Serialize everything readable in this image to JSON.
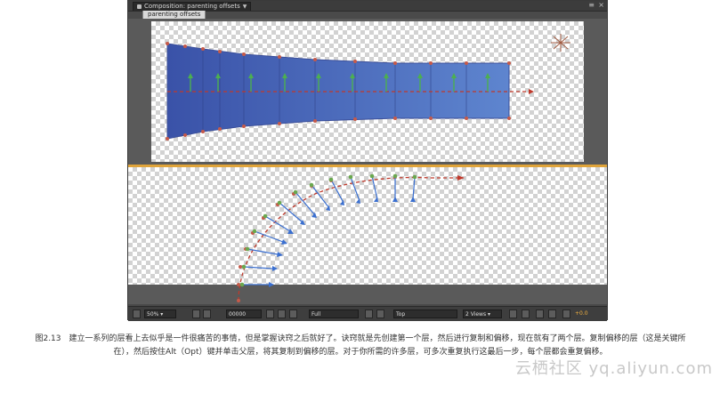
{
  "window": {
    "comp_tab_label": "Composition: parenting offsets",
    "breadcrumb": "parenting offsets",
    "panel_menu_glyph": "≡",
    "close_glyph": "×"
  },
  "statusbar": {
    "zoom": "50%",
    "timecode": "00000",
    "resolution": "Full",
    "view": "Top",
    "view_layout": "2 Views",
    "exposure": "+0.0"
  },
  "caption": {
    "text": "图2.13　建立一系列的层看上去似乎是一件很痛苦的事情，但是掌握诀窍之后就好了。诀窍就是先创建第一个层，然后进行复制和偏移，现在就有了两个层。复制偏移的层（这是关键所在），然后按住Alt（Opt）键并单击父层，将其复制到偏移的层。对于你所需的许多层，可多次重复执行这最后一步，每个层都会重复偏移。"
  },
  "watermark": {
    "text": "云栖社区 yq.aliyun.com"
  },
  "colors": {
    "panel": "#4a4a4a",
    "viewer_bg": "#5a5a5a",
    "layer_blue": "#4f6fbf",
    "accent_orange": "#e0a43a",
    "axis_red": "#c0392b",
    "axis_green": "#4caf50",
    "axis_blue": "#3a6fd0"
  }
}
